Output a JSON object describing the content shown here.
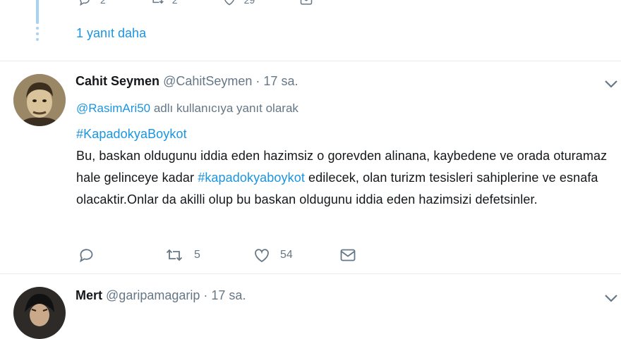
{
  "top_tweet": {
    "actions": [
      {
        "icon": "reply-icon",
        "count": "2"
      },
      {
        "icon": "retweet-icon",
        "count": "2"
      },
      {
        "icon": "like-icon",
        "count": "29"
      },
      {
        "icon": "message-icon",
        "count": ""
      }
    ],
    "more_replies_label": "1 yanıt daha"
  },
  "tweet": {
    "name": "Cahit Seymen",
    "handle": "@CahitSeymen",
    "separator": "·",
    "time": "17 sa.",
    "reply_mention": "@RasimAri50",
    "reply_text": " adlı kullanıcıya yanıt olarak",
    "hashtag_line": "#KapadokyaBoykot",
    "body_part1": "Bu, baskan oldugunu iddia eden hazimsiz o gorevden alinana, kaybedene ve orada oturamaz hale gelinceye kadar ",
    "body_hashtag": "#kapadokyaboykot",
    "body_part2": " edilecek, olan turizm tesisleri sahiplerine ve esnafa olacaktir.Onlar da akilli olup bu baskan oldugunu iddia eden hazimsizi defetsinler.",
    "actions": {
      "reply_count": "",
      "retweet_count": "5",
      "like_count": "54"
    }
  },
  "next_tweet": {
    "name": "Mert",
    "handle": "@garipamagarip",
    "separator": "·",
    "time": "17 sa."
  },
  "colors": {
    "link": "#1b95e0",
    "muted": "#657786",
    "thread": "#a8d3f0"
  }
}
